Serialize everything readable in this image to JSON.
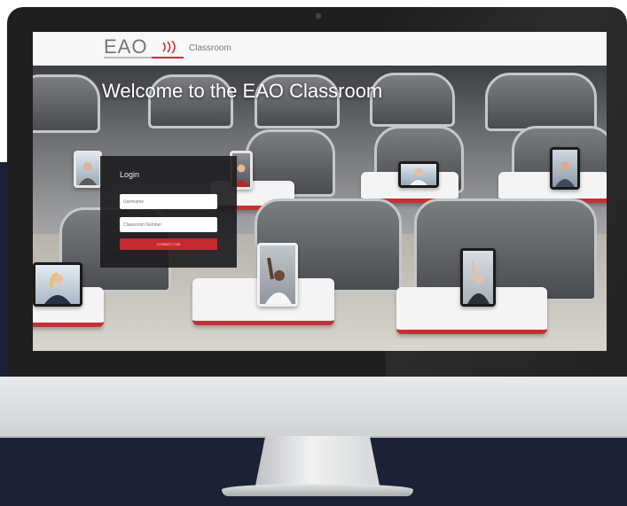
{
  "site": {
    "logo_text": "EAO",
    "nav_label": "Classroom",
    "welcome_heading": "Welcome to the EAO Classroom"
  },
  "login": {
    "title": "Login",
    "username_placeholder": "Username",
    "classroom_placeholder": "Classroom Number",
    "connect_label": "CONNECT ME"
  },
  "colors": {
    "brand_red": "#c62a30",
    "panel_dark": "#1c1c1e",
    "backdrop_navy": "#1d2137"
  }
}
